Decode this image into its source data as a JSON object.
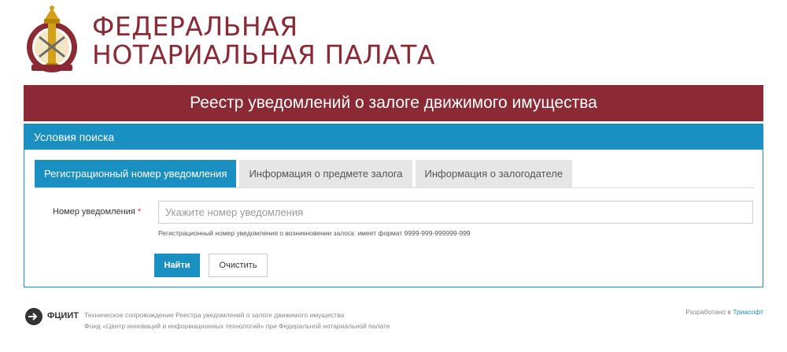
{
  "header": {
    "org_line1": "ФЕДЕРАЛЬНАЯ",
    "org_line2": "НОТАРИАЛЬНАЯ ПАЛАТА",
    "logo_icon": "notary-emblem-icon"
  },
  "banner": {
    "title": "Реестр уведомлений о залоге движимого имущества"
  },
  "search": {
    "panel_title": "Условия поиска",
    "tabs": [
      {
        "label": "Регистрационный номер уведомления",
        "active": true
      },
      {
        "label": "Информация о предмете залога",
        "active": false
      },
      {
        "label": "Информация о залогодателе",
        "active": false
      }
    ],
    "field_label": "Номер уведомления",
    "required_mark": "*",
    "placeholder": "Укажите номер уведомления",
    "value": "",
    "hint": "Регистрационный номер уведомления о возникновении залога: имеет формат 9999-999-999999-999",
    "find_label": "Найти",
    "clear_label": "Очистить"
  },
  "footer": {
    "brand": "ФЦИИТ",
    "line1": "Техническое сопровождение Реестра уведомлений о залоге движимого имущества",
    "line2": "Фонд «Центр инноваций и информационных технологий» при Федеральной нотариальной палате",
    "developed_by": "Разработано в",
    "developer": "Триасофт"
  },
  "colors": {
    "brand_red": "#8b2a35",
    "accent_blue": "#1a8fc1"
  }
}
